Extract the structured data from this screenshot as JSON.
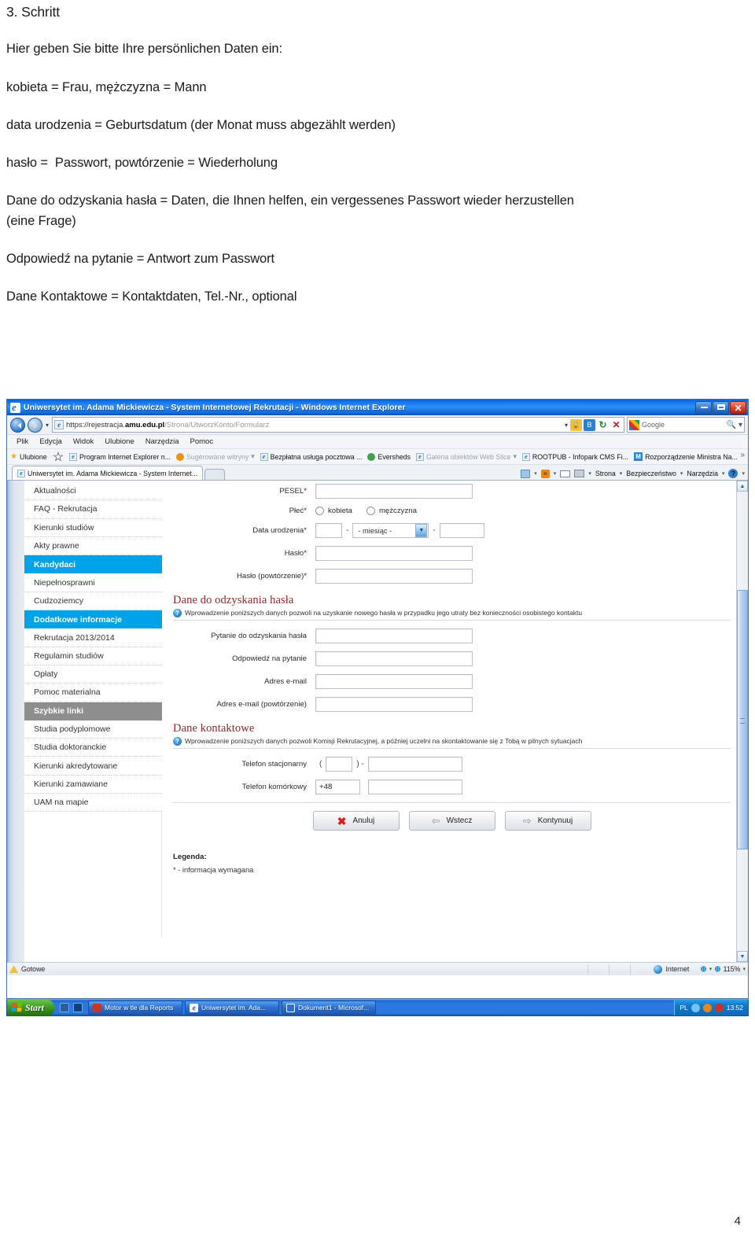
{
  "document": {
    "heading": "3. Schritt",
    "lines": [
      "Hier geben Sie bitte Ihre persönlichen Daten ein:",
      "kobieta = Frau, mężczyzna = Mann",
      "data urodzenia = Geburtsdatum (der Monat muss abgezählt werden)",
      "hasło =  Passwort, powtórzenie = Wiederholung",
      "Dane do odzyskania hasła = Daten, die Ihnen helfen, ein vergessenes Passwort wieder herzustellen",
      "(eine Frage)",
      "Odpowiedź na pytanie = Antwort zum Passwort",
      "Dane Kontaktowe = Kontaktdaten, Tel.-Nr., optional"
    ],
    "page_number": "4"
  },
  "browser": {
    "title": "Uniwersytet im. Adama Mickiewicza - System Internetowej Rekrutacji - Windows Internet Explorer",
    "window_buttons": {
      "minimize": "_",
      "maximize": "▫",
      "close": "✕"
    },
    "address": {
      "scheme": "https://rejestracja.",
      "domain": "amu.edu.pl",
      "path": "/Strona/UtworzKonto/Formularz"
    },
    "search_placeholder": "Google",
    "menu": [
      "Plik",
      "Edycja",
      "Widok",
      "Ulubione",
      "Narzędzia",
      "Pomoc"
    ],
    "favorites_label": "Ulubione",
    "favorites": [
      "Program Internet Explorer n...",
      "Sugerowane witryny",
      "Bezpłatna usługa pocztowa ...",
      "Eversheds",
      "Galeria obiektów Web Slice",
      "ROOTPUB - Infopark CMS Fi...",
      "Rozporządzenie Ministra Na..."
    ],
    "tab_label": "Uniwersytet im. Adama Mickiewicza - System Internet...",
    "command_bar": [
      "Strona",
      "Bezpieczeństwo",
      "Narzędzia"
    ],
    "status": {
      "ready": "Gotowe",
      "zone": "Internet",
      "zoom": "115%"
    }
  },
  "site": {
    "sidebar": [
      {
        "label": "Aktualności",
        "style": "normal"
      },
      {
        "label": "FAQ - Rekrutacja",
        "style": "normal"
      },
      {
        "label": "Kierunki studiów",
        "style": "normal"
      },
      {
        "label": "Akty prawne",
        "style": "normal"
      },
      {
        "label": "Kandydaci",
        "style": "highlight"
      },
      {
        "label": "Niepełnosprawni",
        "style": "normal"
      },
      {
        "label": "Cudzoziemcy",
        "style": "normal"
      },
      {
        "label": "Dodatkowe informacje",
        "style": "highlight"
      },
      {
        "label": "Rekrutacja 2013/2014",
        "style": "normal"
      },
      {
        "label": "Regulamin studiów",
        "style": "normal"
      },
      {
        "label": "Opłaty",
        "style": "normal"
      },
      {
        "label": "Pomoc materialna",
        "style": "normal"
      },
      {
        "label": "Szybkie linki",
        "style": "grey"
      },
      {
        "label": "Studia podyplomowe",
        "style": "normal"
      },
      {
        "label": "Studia doktoranckie",
        "style": "normal"
      },
      {
        "label": "Kierunki akredytowane",
        "style": "normal"
      },
      {
        "label": "Kierunki zamawiane",
        "style": "normal"
      },
      {
        "label": "UAM na mapie",
        "style": "normal"
      }
    ],
    "form": {
      "pesel_label": "PESEL*",
      "pesel_value": "",
      "gender_label": "Płeć*",
      "gender_options": [
        "kobieta",
        "mężczyzna"
      ],
      "birth_label": "Data urodzenia*",
      "birth_day": "",
      "birth_month": "- miesiąc -",
      "birth_year": "",
      "separator": "-",
      "password_label": "Hasło*",
      "password_value": "",
      "password_repeat_label": "Hasło (powtórzenie)*",
      "password_repeat_value": ""
    },
    "recovery": {
      "title": "Dane do odzyskania hasła",
      "hint": "Wprowadzenie poniższych danych pozwoli na uzyskanie nowego hasła w przypadku jego utraty bez konieczności osobistego kontaktu",
      "fields": [
        {
          "label": "Pytanie do odzyskania hasła",
          "value": ""
        },
        {
          "label": "Odpowiedź na pytanie",
          "value": ""
        },
        {
          "label": "Adres e-mail",
          "value": ""
        },
        {
          "label": "Adres e-mail (powtórzenie)",
          "value": ""
        }
      ]
    },
    "contact": {
      "title": "Dane kontaktowe",
      "hint": "Wprowadzenie poniższych danych pozwoli Komisji Rekrutacyjnej, a później uczelni na skontaktowanie się z Tobą w pilnych sytuacjach",
      "landline_label": "Telefon stacjonarny",
      "landline_open": "(",
      "landline_close": ") -",
      "landline_area": "",
      "landline_number": "",
      "mobile_label": "Telefon komórkowy",
      "mobile_prefix": "+48",
      "mobile_number": ""
    },
    "buttons": [
      {
        "label": "Anuluj",
        "icon": "red-x-icon"
      },
      {
        "label": "Wstecz",
        "icon": "arrow-left-icon"
      },
      {
        "label": "Kontynuuj",
        "icon": "arrow-right-icon"
      }
    ],
    "legend": {
      "title": "Legenda:",
      "required": "* - informacja wymagana"
    }
  },
  "taskbar": {
    "start": "Start",
    "tasks": [
      "Motor w tle dla Reports",
      "Uniwersytet im. Ada...",
      "Dokument1 - Microsof..."
    ],
    "language": "PL",
    "clock": "13:52"
  },
  "colors": {
    "accent": "#00a2e8",
    "grey_nav": "#8e8e8e",
    "section_heading": "#8c2b2b",
    "titlebar": "#1273e8"
  }
}
